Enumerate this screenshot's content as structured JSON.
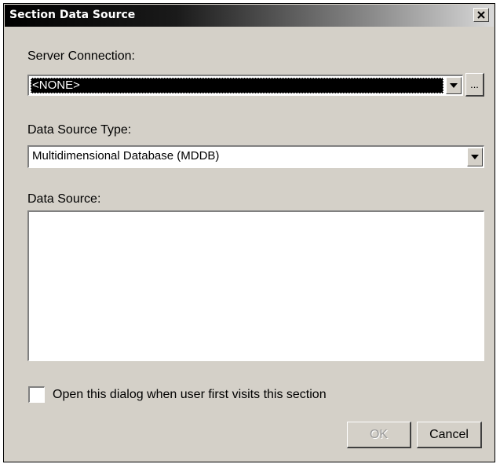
{
  "dialog": {
    "title": "Section Data Source",
    "close_icon": "close-icon"
  },
  "server_connection": {
    "label": "Server Connection:",
    "value": "<NONE>",
    "browse_label": "..."
  },
  "data_source_type": {
    "label": "Data Source Type:",
    "value": "Multidimensional Database (MDDB)"
  },
  "data_source": {
    "label": "Data Source:",
    "value": ""
  },
  "open_on_first_visit": {
    "label": "Open this dialog when user first visits this section",
    "checked": false
  },
  "buttons": {
    "ok": "OK",
    "cancel": "Cancel"
  }
}
